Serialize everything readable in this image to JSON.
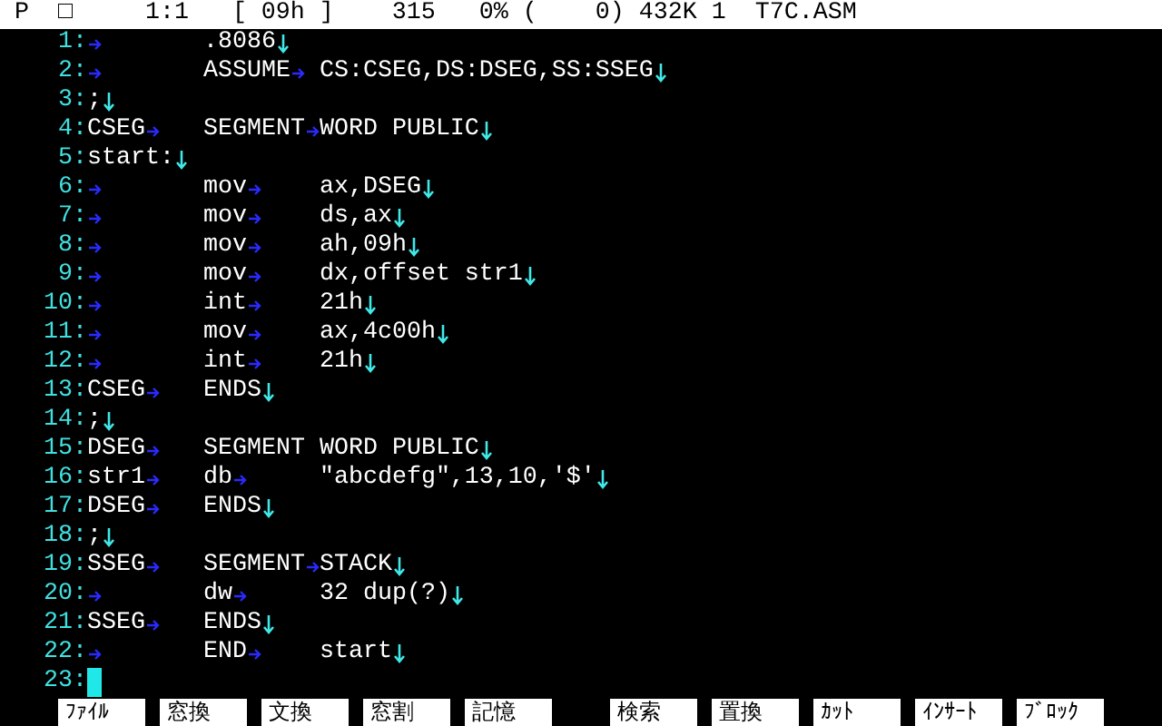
{
  "status_bar": {
    "fields": [
      "P",
      "□",
      "1:1",
      "[ 09h ]",
      "315",
      "0% (    0)",
      "432K",
      "1",
      "T7C.ASM"
    ]
  },
  "lines": [
    {
      "number": "1:",
      "cursor": false,
      "segments": [
        {
          "kind": "tab"
        },
        {
          "kind": "text",
          "text": ".8086"
        },
        {
          "kind": "eol"
        }
      ]
    },
    {
      "number": "2:",
      "cursor": false,
      "segments": [
        {
          "kind": "tab"
        },
        {
          "kind": "text",
          "text": "ASSUME"
        },
        {
          "kind": "tab"
        },
        {
          "kind": "text",
          "text": "CS:CSEG,DS:DSEG,SS:SSEG"
        },
        {
          "kind": "eol"
        }
      ]
    },
    {
      "number": "3:",
      "cursor": false,
      "segments": [
        {
          "kind": "text",
          "text": ";"
        },
        {
          "kind": "eol"
        }
      ]
    },
    {
      "number": "4:",
      "cursor": false,
      "segments": [
        {
          "kind": "text",
          "text": "CSEG"
        },
        {
          "kind": "tab"
        },
        {
          "kind": "text",
          "text": "SEGMENT"
        },
        {
          "kind": "tab"
        },
        {
          "kind": "text",
          "text": "WORD PUBLIC"
        },
        {
          "kind": "eol"
        }
      ]
    },
    {
      "number": "5:",
      "cursor": false,
      "segments": [
        {
          "kind": "text",
          "text": "start:"
        },
        {
          "kind": "eol"
        }
      ]
    },
    {
      "number": "6:",
      "cursor": false,
      "segments": [
        {
          "kind": "tab"
        },
        {
          "kind": "text",
          "text": "mov"
        },
        {
          "kind": "tab"
        },
        {
          "kind": "text",
          "text": "ax,DSEG"
        },
        {
          "kind": "eol"
        }
      ]
    },
    {
      "number": "7:",
      "cursor": false,
      "segments": [
        {
          "kind": "tab"
        },
        {
          "kind": "text",
          "text": "mov"
        },
        {
          "kind": "tab"
        },
        {
          "kind": "text",
          "text": "ds,ax"
        },
        {
          "kind": "eol"
        }
      ]
    },
    {
      "number": "8:",
      "cursor": false,
      "segments": [
        {
          "kind": "tab"
        },
        {
          "kind": "text",
          "text": "mov"
        },
        {
          "kind": "tab"
        },
        {
          "kind": "text",
          "text": "ah,09h"
        },
        {
          "kind": "eol"
        }
      ]
    },
    {
      "number": "9:",
      "cursor": false,
      "segments": [
        {
          "kind": "tab"
        },
        {
          "kind": "text",
          "text": "mov"
        },
        {
          "kind": "tab"
        },
        {
          "kind": "text",
          "text": "dx,offset str1"
        },
        {
          "kind": "eol"
        }
      ]
    },
    {
      "number": "10:",
      "cursor": false,
      "segments": [
        {
          "kind": "tab"
        },
        {
          "kind": "text",
          "text": "int"
        },
        {
          "kind": "tab"
        },
        {
          "kind": "text",
          "text": "21h"
        },
        {
          "kind": "eol"
        }
      ]
    },
    {
      "number": "11:",
      "cursor": false,
      "segments": [
        {
          "kind": "tab"
        },
        {
          "kind": "text",
          "text": "mov"
        },
        {
          "kind": "tab"
        },
        {
          "kind": "text",
          "text": "ax,4c00h"
        },
        {
          "kind": "eol"
        }
      ]
    },
    {
      "number": "12:",
      "cursor": false,
      "segments": [
        {
          "kind": "tab"
        },
        {
          "kind": "text",
          "text": "int"
        },
        {
          "kind": "tab"
        },
        {
          "kind": "text",
          "text": "21h"
        },
        {
          "kind": "eol"
        }
      ]
    },
    {
      "number": "13:",
      "cursor": false,
      "segments": [
        {
          "kind": "text",
          "text": "CSEG"
        },
        {
          "kind": "tab"
        },
        {
          "kind": "text",
          "text": "ENDS"
        },
        {
          "kind": "eol"
        }
      ]
    },
    {
      "number": "14:",
      "cursor": false,
      "segments": [
        {
          "kind": "text",
          "text": ";"
        },
        {
          "kind": "eol"
        }
      ]
    },
    {
      "number": "15:",
      "cursor": false,
      "segments": [
        {
          "kind": "text",
          "text": "DSEG"
        },
        {
          "kind": "tab"
        },
        {
          "kind": "text",
          "text": "SEGMENT WORD PUBLIC"
        },
        {
          "kind": "eol"
        }
      ]
    },
    {
      "number": "16:",
      "cursor": false,
      "segments": [
        {
          "kind": "text",
          "text": "str1"
        },
        {
          "kind": "tab"
        },
        {
          "kind": "text",
          "text": "db"
        },
        {
          "kind": "tab"
        },
        {
          "kind": "text",
          "text": "\"abcdefg\",13,10,'$'"
        },
        {
          "kind": "eol"
        }
      ]
    },
    {
      "number": "17:",
      "cursor": false,
      "segments": [
        {
          "kind": "text",
          "text": "DSEG"
        },
        {
          "kind": "tab"
        },
        {
          "kind": "text",
          "text": "ENDS"
        },
        {
          "kind": "eol"
        }
      ]
    },
    {
      "number": "18:",
      "cursor": false,
      "segments": [
        {
          "kind": "text",
          "text": ";"
        },
        {
          "kind": "eol"
        }
      ]
    },
    {
      "number": "19:",
      "cursor": false,
      "segments": [
        {
          "kind": "text",
          "text": "SSEG"
        },
        {
          "kind": "tab"
        },
        {
          "kind": "text",
          "text": "SEGMENT"
        },
        {
          "kind": "tab"
        },
        {
          "kind": "text",
          "text": "STACK"
        },
        {
          "kind": "eol"
        }
      ]
    },
    {
      "number": "20:",
      "cursor": false,
      "segments": [
        {
          "kind": "tab"
        },
        {
          "kind": "text",
          "text": "dw"
        },
        {
          "kind": "tab"
        },
        {
          "kind": "text",
          "text": "32 dup(?)"
        },
        {
          "kind": "eol"
        }
      ]
    },
    {
      "number": "21:",
      "cursor": false,
      "segments": [
        {
          "kind": "text",
          "text": "SSEG"
        },
        {
          "kind": "tab"
        },
        {
          "kind": "text",
          "text": "ENDS"
        },
        {
          "kind": "eol"
        }
      ]
    },
    {
      "number": "22:",
      "cursor": false,
      "segments": [
        {
          "kind": "tab"
        },
        {
          "kind": "text",
          "text": "END"
        },
        {
          "kind": "tab"
        },
        {
          "kind": "text",
          "text": "start"
        },
        {
          "kind": "eol"
        }
      ]
    },
    {
      "number": "23:",
      "cursor": true
    }
  ],
  "function_keys": [
    "ﾌｧｲﾙ",
    "窓換",
    "文換",
    "窓割",
    "記憶",
    "検索",
    "置換",
    "ｶｯﾄ",
    "ｲﾝｻｰﾄ",
    "ﾌﾞﾛｯｸ"
  ]
}
